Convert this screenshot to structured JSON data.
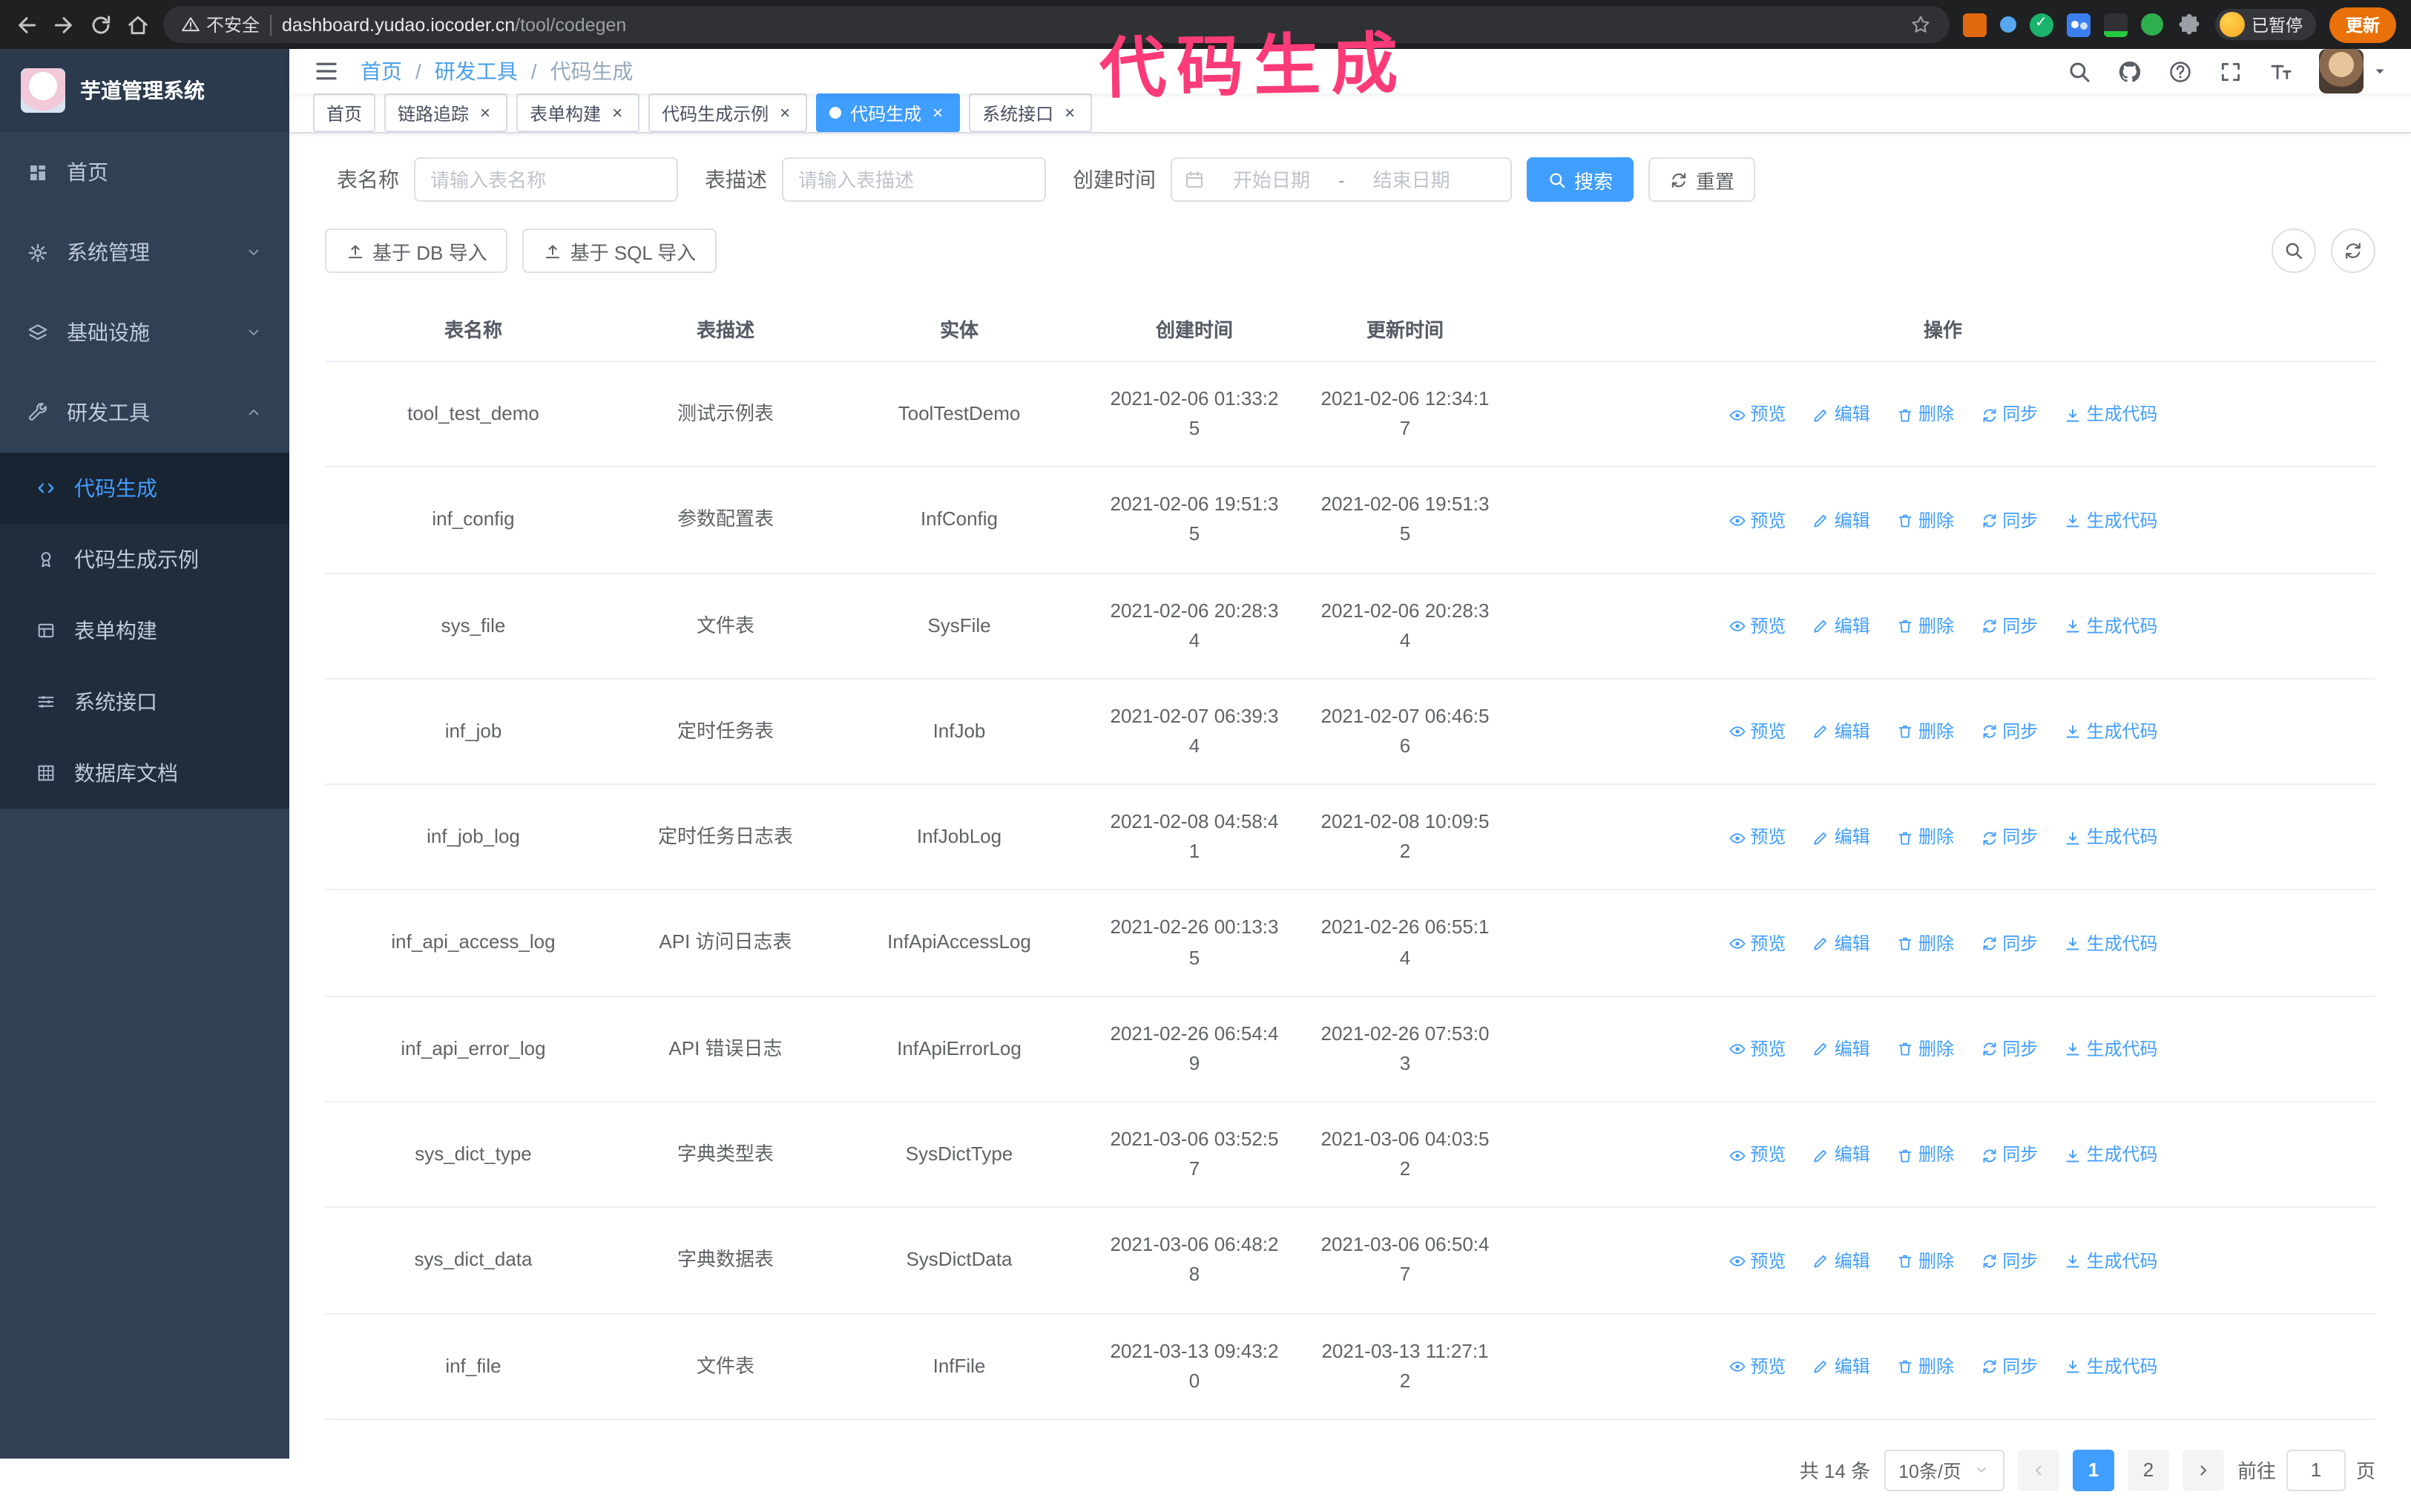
{
  "annotation": {
    "text": "代码生成"
  },
  "browser": {
    "security_label": "不安全",
    "url_host": "dashboard.yudao.iocoder.cn",
    "url_path": "/tool/codegen",
    "profile_label": "已暂停",
    "update_label": "更新"
  },
  "sidebar": {
    "logo_title": "芋道管理系统",
    "items": [
      {
        "label": "首页"
      },
      {
        "label": "系统管理"
      },
      {
        "label": "基础设施"
      },
      {
        "label": "研发工具"
      }
    ],
    "subitems": [
      {
        "label": "代码生成"
      },
      {
        "label": "代码生成示例"
      },
      {
        "label": "表单构建"
      },
      {
        "label": "系统接口"
      },
      {
        "label": "数据库文档"
      }
    ]
  },
  "header": {
    "breadcrumb": [
      "首页",
      "研发工具",
      "代码生成"
    ]
  },
  "tags": [
    {
      "label": "首页"
    },
    {
      "label": "链路追踪"
    },
    {
      "label": "表单构建"
    },
    {
      "label": "代码生成示例"
    },
    {
      "label": "代码生成"
    },
    {
      "label": "系统接口"
    }
  ],
  "filters": {
    "table_name_label": "表名称",
    "table_name_placeholder": "请输入表名称",
    "table_desc_label": "表描述",
    "table_desc_placeholder": "请输入表描述",
    "create_time_label": "创建时间",
    "date_start_placeholder": "开始日期",
    "date_separator": "-",
    "date_end_placeholder": "结束日期",
    "search_label": "搜索",
    "reset_label": "重置"
  },
  "toolbar": {
    "import_db": "基于 DB 导入",
    "import_sql": "基于 SQL 导入"
  },
  "table": {
    "columns": [
      "表名称",
      "表描述",
      "实体",
      "创建时间",
      "更新时间",
      "操作"
    ],
    "ops": {
      "preview": "预览",
      "edit": "编辑",
      "delete": "删除",
      "sync": "同步",
      "generate": "生成代码"
    },
    "rows": [
      {
        "name": "tool_test_demo",
        "desc": "测试示例表",
        "entity": "ToolTestDemo",
        "created": "2021-02-06 01:33:25",
        "updated": "2021-02-06 12:34:17"
      },
      {
        "name": "inf_config",
        "desc": "参数配置表",
        "entity": "InfConfig",
        "created": "2021-02-06 19:51:35",
        "updated": "2021-02-06 19:51:35"
      },
      {
        "name": "sys_file",
        "desc": "文件表",
        "entity": "SysFile",
        "created": "2021-02-06 20:28:34",
        "updated": "2021-02-06 20:28:34"
      },
      {
        "name": "inf_job",
        "desc": "定时任务表",
        "entity": "InfJob",
        "created": "2021-02-07 06:39:34",
        "updated": "2021-02-07 06:46:56"
      },
      {
        "name": "inf_job_log",
        "desc": "定时任务日志表",
        "entity": "InfJobLog",
        "created": "2021-02-08 04:58:41",
        "updated": "2021-02-08 10:09:52"
      },
      {
        "name": "inf_api_access_log",
        "desc": "API 访问日志表",
        "entity": "InfApiAccessLog",
        "created": "2021-02-26 00:13:35",
        "updated": "2021-02-26 06:55:14"
      },
      {
        "name": "inf_api_error_log",
        "desc": "API 错误日志",
        "entity": "InfApiErrorLog",
        "created": "2021-02-26 06:54:49",
        "updated": "2021-02-26 07:53:03"
      },
      {
        "name": "sys_dict_type",
        "desc": "字典类型表",
        "entity": "SysDictType",
        "created": "2021-03-06 03:52:57",
        "updated": "2021-03-06 04:03:52"
      },
      {
        "name": "sys_dict_data",
        "desc": "字典数据表",
        "entity": "SysDictData",
        "created": "2021-03-06 06:48:28",
        "updated": "2021-03-06 06:50:47"
      },
      {
        "name": "inf_file",
        "desc": "文件表",
        "entity": "InfFile",
        "created": "2021-03-13 09:43:20",
        "updated": "2021-03-13 11:27:12"
      }
    ]
  },
  "pagination": {
    "total": "共 14 条",
    "page_size": "10条/页",
    "page1": "1",
    "page2": "2",
    "goto_label": "前往",
    "goto_value": "1",
    "unit": "页"
  },
  "colors": {
    "accent": "#409eff",
    "sidebar_bg": "#304156",
    "submenu_bg": "#1f2d3d",
    "annotation": "#fb3b77"
  }
}
